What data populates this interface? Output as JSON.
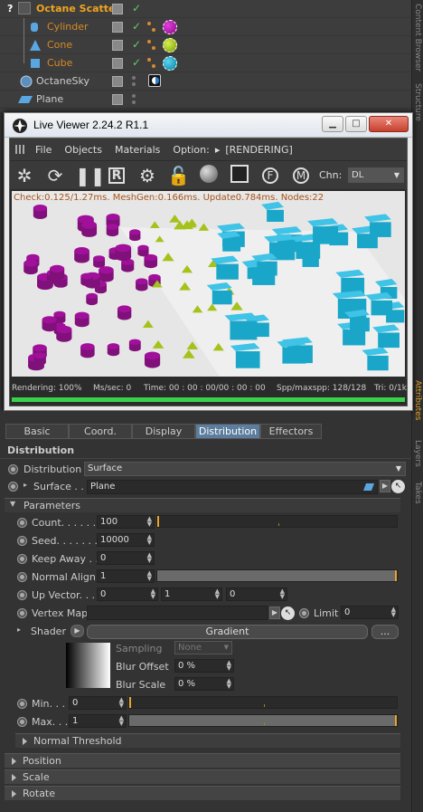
{
  "objects": [
    {
      "label": "Octane Scatter",
      "prefix": "?"
    },
    {
      "label": "Cylinder"
    },
    {
      "label": "Cone"
    },
    {
      "label": "Cube"
    },
    {
      "label": "OctaneSky"
    },
    {
      "label": "Plane"
    }
  ],
  "side_tabs": {
    "tab1": "Content Browser",
    "tab2": "Structure",
    "tab3": "Attributes",
    "tab4": "Layers",
    "tab5": "Takes"
  },
  "live_viewer": {
    "title": "Live Viewer 2.24.2 R1.1",
    "controls": {
      "minimize": "▁",
      "maximize": "□",
      "close": "✕"
    },
    "menu": {
      "file": "File",
      "objects": "Objects",
      "materials": "Materials",
      "option": "Option:",
      "arrow": "▸",
      "status": "[RENDERING]"
    },
    "chn_label": "Chn:",
    "chn_value": "DL",
    "check_line": "Check:0.125/1.27ms. MeshGen:0.166ms. Update0.784ms. Nodes:22",
    "statusbar": {
      "rendering": "Rendering: 100%",
      "mssec": "Ms/sec: 0",
      "time": "Time: 00 : 00 : 00/00 : 00 : 00",
      "spp": "Spp/maxspp: 128/128",
      "tri": "Tri: 0/1k"
    },
    "progress": 1.0
  },
  "attr": {
    "tabs": {
      "basic": "Basic",
      "coord": "Coord.",
      "display": "Display",
      "distribution": "Distribution",
      "effectors": "Effectors"
    },
    "section_title": "Distribution",
    "distribution": {
      "label": "Distribution",
      "value": "Surface"
    },
    "surface": {
      "label": "Surface . .",
      "value": "Plane"
    },
    "parameters": "Parameters",
    "count": {
      "label": "Count. . . . . .",
      "value": "100",
      "level": 0.0
    },
    "seed": {
      "label": "Seed. . . . . . .",
      "value": "10000"
    },
    "keep_away": {
      "label": "Keep Away . .",
      "value": "0"
    },
    "normal_align": {
      "label": "Normal Align",
      "value": "1",
      "level": 1.0
    },
    "up_vector": {
      "label": "Up Vector. . .",
      "x": "0",
      "y": "1",
      "z": "0"
    },
    "vertex_map": {
      "label": "Vertex Map"
    },
    "limit": {
      "label": "Limit",
      "value": "0"
    },
    "shader": {
      "label": "Shader",
      "button": "Gradient",
      "more": "..."
    },
    "sampling": {
      "label": "Sampling",
      "value": "None"
    },
    "blur_offset": {
      "label": "Blur Offset",
      "value": "0 %"
    },
    "blur_scale": {
      "label": "Blur Scale",
      "value": "0 %"
    },
    "min": {
      "label": "Min. . .",
      "value": "0",
      "level": 0.0
    },
    "max": {
      "label": "Max. . .",
      "value": "1",
      "level": 1.0
    },
    "normal_threshold": "Normal Threshold",
    "position": "Position",
    "scale": "Scale",
    "rotate": "Rotate"
  },
  "colors": {
    "accent_orange": "#e8a42c",
    "active_tab": "#5c7d9d",
    "cylinder": "#a0109a",
    "cone": "#a4c21a",
    "cube": "#1aa6c8",
    "progress": "#38d24a"
  }
}
